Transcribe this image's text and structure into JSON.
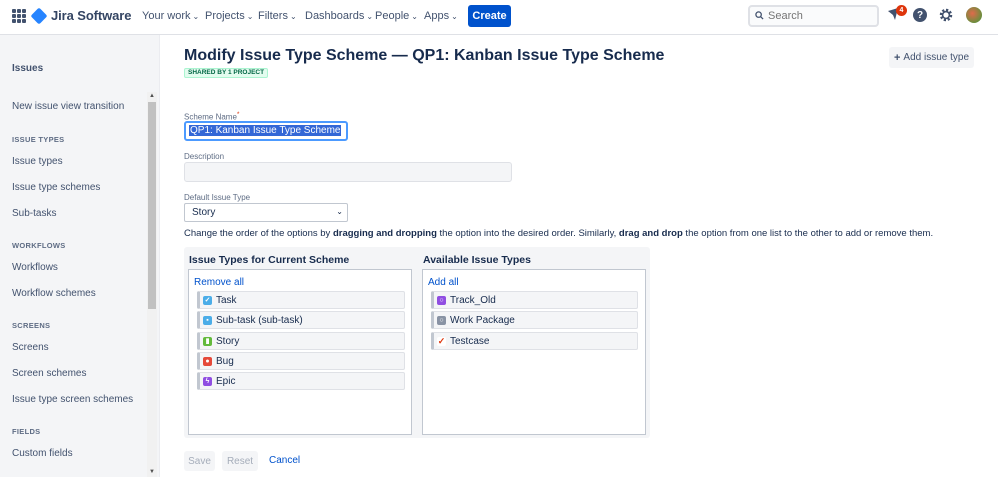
{
  "nav": {
    "product_name": "Jira Software",
    "items": [
      "Your work",
      "Projects",
      "Filters",
      "Dashboards",
      "People",
      "Apps"
    ],
    "create_label": "Create",
    "search_placeholder": "Search",
    "notification_count": "4",
    "help_glyph": "?"
  },
  "sidebar": {
    "title": "Issues",
    "top_item": "New issue view transition",
    "sections": [
      {
        "header": "ISSUE TYPES",
        "items": [
          "Issue types",
          "Issue type schemes",
          "Sub-tasks"
        ]
      },
      {
        "header": "WORKFLOWS",
        "items": [
          "Workflows",
          "Workflow schemes"
        ]
      },
      {
        "header": "SCREENS",
        "items": [
          "Screens",
          "Screen schemes",
          "Issue type screen schemes"
        ]
      },
      {
        "header": "FIELDS",
        "items": [
          "Custom fields"
        ]
      }
    ]
  },
  "main": {
    "title": "Modify Issue Type Scheme — QP1: Kanban Issue Type Scheme",
    "shared_tag": "SHARED BY 1 PROJECT",
    "add_issue_type": "Add issue type",
    "scheme_name_label": "Scheme Name",
    "required_mark": "*",
    "scheme_name_value": "QP1: Kanban Issue Type Scheme",
    "description_label": "Description",
    "default_type_label": "Default Issue Type",
    "default_type_value": "Story",
    "instructions": {
      "p1": "Change the order of the options by ",
      "b1": "dragging and dropping",
      "p2": " the option into the desired order. Similarly, ",
      "b2": "drag and drop",
      "p3": " the option from one list to the other to add or remove them."
    },
    "current": {
      "title": "Issue Types for Current Scheme",
      "action": "Remove all",
      "items": [
        "Task",
        "Sub-task (sub-task)",
        "Story",
        "Bug",
        "Epic"
      ]
    },
    "available": {
      "title": "Available Issue Types",
      "action": "Add all",
      "items": [
        "Track_Old",
        "Work Package",
        "Testcase"
      ]
    },
    "save_label": "Save",
    "reset_label": "Reset",
    "cancel_label": "Cancel"
  },
  "colors": {
    "task": "#4bade8",
    "subtask": "#4bade8",
    "story": "#63ba3c",
    "bug": "#e5493a",
    "epic": "#904ee2",
    "track_old": "#904ee2",
    "work_package": "#8993a4",
    "testcase": "#de350b"
  }
}
